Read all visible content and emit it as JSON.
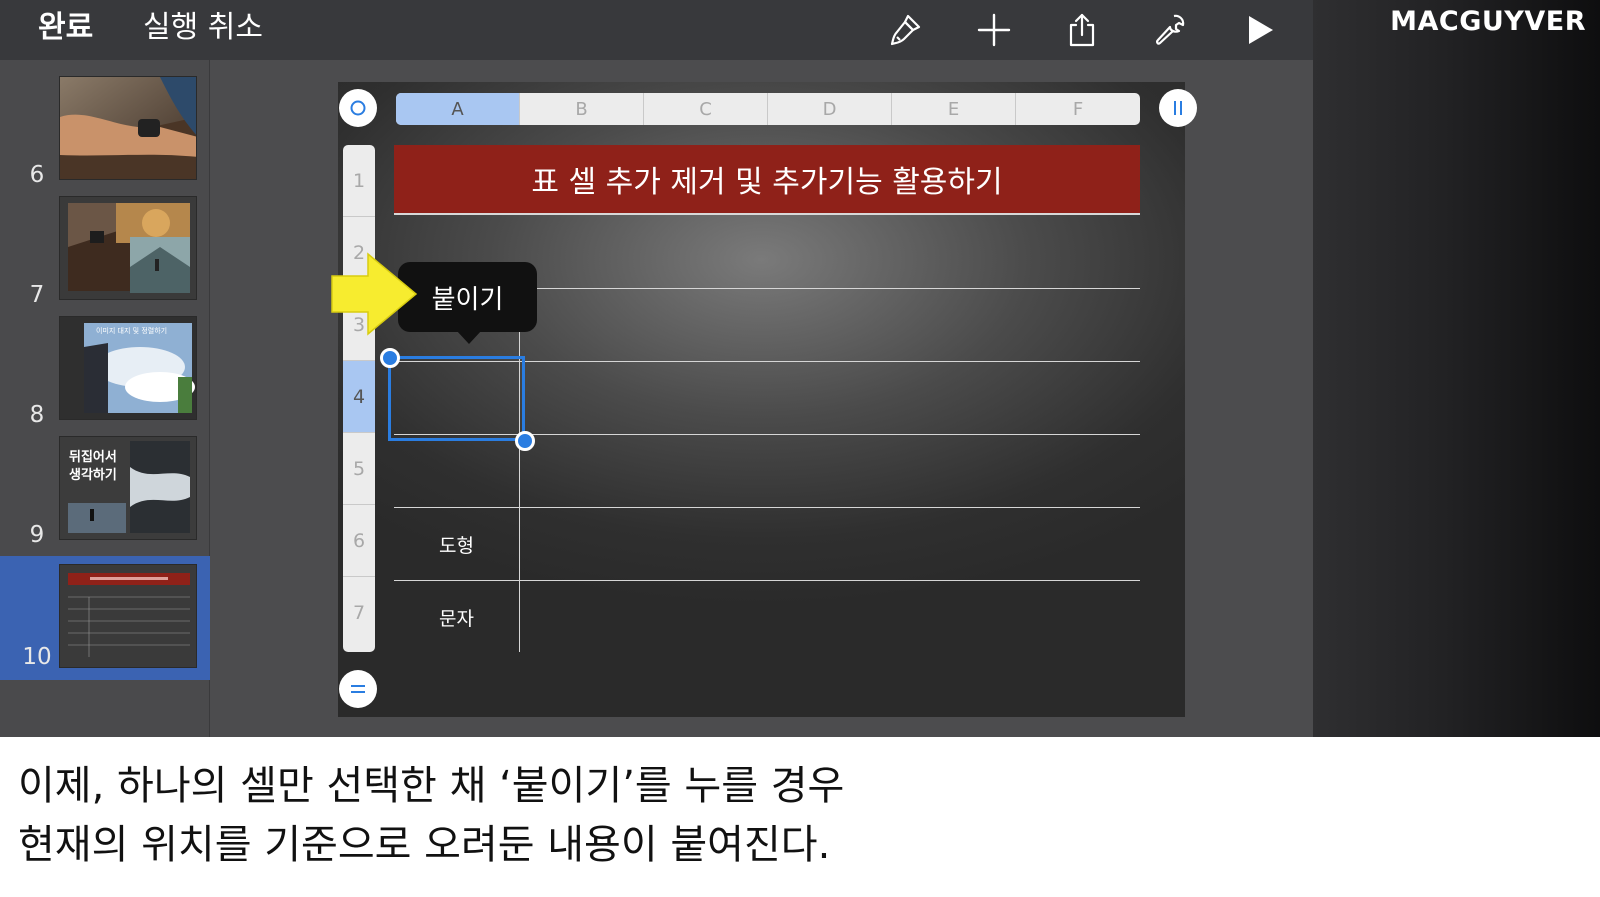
{
  "toolbar": {
    "done_label": "완료",
    "undo_label": "실행 취소",
    "icons": [
      "brush-icon",
      "plus-icon",
      "share-icon",
      "wrench-icon",
      "play-icon"
    ]
  },
  "brand": {
    "text": "MACGUYVER"
  },
  "navigator": {
    "slides": [
      {
        "number": "6",
        "thumb": "watch-photo"
      },
      {
        "number": "7",
        "thumb": "collage-photo"
      },
      {
        "number": "8",
        "thumb": "sky-photo",
        "thumb_title": "이미지 대지 및 정렬하기"
      },
      {
        "number": "9",
        "thumb": "reflection-photo",
        "thumb_text": [
          "뒤집어서",
          "생각하기"
        ]
      },
      {
        "number": "10",
        "thumb": "table-slide",
        "selected": true
      }
    ]
  },
  "table": {
    "columns": [
      "A",
      "B",
      "C",
      "D",
      "E",
      "F"
    ],
    "active_column": "A",
    "rows": [
      "1",
      "2",
      "3",
      "4",
      "5",
      "6",
      "7"
    ],
    "active_row": "4",
    "title": "표 셀 추가 제거 및 추가기능 활용하기",
    "cell_labels": {
      "row6": "도형",
      "row7": "문자"
    }
  },
  "popup": {
    "label": "붙이기"
  },
  "colors": {
    "accent": "#2a7de1",
    "title_red": "#8f2119",
    "highlight": "#a9c7f2",
    "arrow": "#f7ec2f",
    "selected_slide": "#3b63b2"
  },
  "caption": {
    "line1": "이제, 하나의 셀만 선택한 채 ‘붙이기’를 누를 경우",
    "line2": "현재의 위치를 기준으로 오려둔 내용이 붙여진다."
  }
}
